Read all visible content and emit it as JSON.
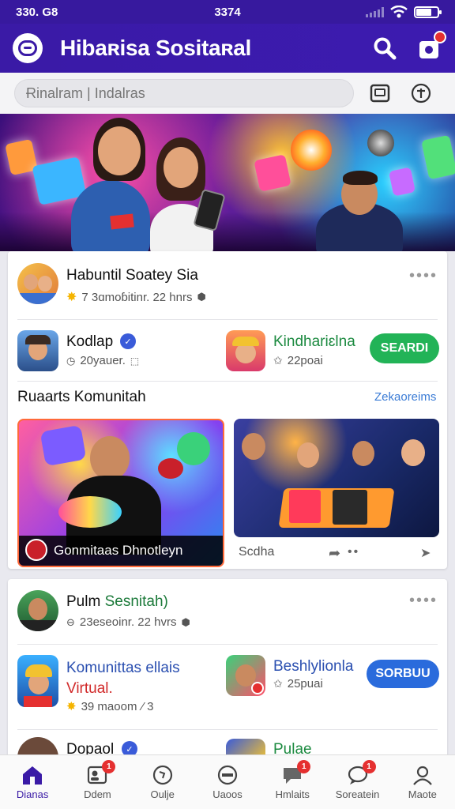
{
  "status_bar": {
    "time_left": "330. G8",
    "time_center": "3374"
  },
  "app_bar": {
    "title": "Hibaʀisa Sositaʀal"
  },
  "search": {
    "placeholder": "Ɍinalram | Indalras"
  },
  "colors": {
    "primary": "#3a1aa6",
    "accent_green": "#22b357",
    "accent_blue": "#2a6bdc",
    "badge_red": "#e53030",
    "link": "#3a7bd5"
  },
  "card1": {
    "header": {
      "title": "Habuntil Soatey Sia",
      "meta": "7 3ɑmoɓitinr. 22 hnrs",
      "more": "••••"
    },
    "row": {
      "left": {
        "title": "Kodlap",
        "meta": "20yauer."
      },
      "right": {
        "title": "Kindhariɛlna",
        "meta": "22poai",
        "button": "SEARDI"
      }
    },
    "section": {
      "title": "Ruaarts Komunitah",
      "link": "Zekaoreims"
    },
    "media": {
      "left_caption": "Gonmitaas Dhnotleyn",
      "right_caption": "Scdha"
    }
  },
  "card2": {
    "header": {
      "title_part1": "Pulm",
      "title_part2": "Sesnitah)",
      "meta": "23eseoinr. 22 hvrs",
      "more": "••••"
    },
    "row": {
      "left": {
        "title_line1": "Komunittas ellais",
        "title_line2": "Virtual.",
        "meta": "39 maoom",
        "meta_suffix": "⁄ 3"
      },
      "right": {
        "title": "Beshlylionla",
        "meta": "25puai",
        "button": "SORBUU"
      }
    },
    "peek": {
      "left_title": "Dopaol",
      "right_title": "Pulae"
    }
  },
  "bottom_nav": [
    {
      "label": "Dianas",
      "icon": "home-icon",
      "active": true,
      "badge": ""
    },
    {
      "label": "Ddem",
      "icon": "profile-card-icon",
      "badge": "1"
    },
    {
      "label": "Oulje",
      "icon": "explore-icon",
      "badge": ""
    },
    {
      "label": "Uaoos",
      "icon": "group-icon",
      "badge": ""
    },
    {
      "label": "Hmlaits",
      "icon": "chat-icon",
      "badge": "1"
    },
    {
      "label": "Soreatein",
      "icon": "notification-icon",
      "badge": "1"
    },
    {
      "label": "Maote",
      "icon": "user-icon",
      "badge": ""
    }
  ]
}
